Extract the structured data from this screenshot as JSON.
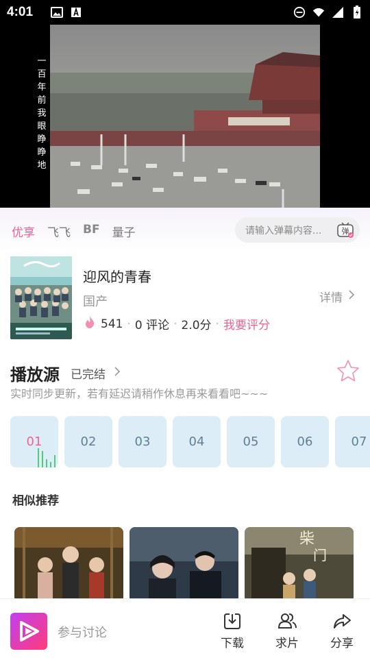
{
  "status_bar": {
    "time": "4:01",
    "icons": [
      "image-icon",
      "a-icon",
      "dnd-icon",
      "wifi-icon",
      "signal-icon",
      "battery-icon"
    ]
  },
  "video": {
    "vertical_caption": "一百年前我眼睁睁地"
  },
  "source_tabs": [
    {
      "label": "优享",
      "active": true
    },
    {
      "label": "飞飞",
      "active": false
    },
    {
      "label": "BF",
      "active": false
    },
    {
      "label": "量子",
      "active": false
    }
  ],
  "danmaku": {
    "placeholder": "请输入弹幕内容...",
    "icon_label": "弹"
  },
  "movie": {
    "title": "迎风的青春",
    "region": "国产",
    "details_label": "详情",
    "heat": "541",
    "comments": "0 评论",
    "score": "2.0分",
    "rate_label": "我要评分"
  },
  "play_source": {
    "title": "播放源",
    "status": "已完结",
    "note": "实时同步更新，若有延迟请稍作休息再来看看吧~~~",
    "episodes": [
      "01",
      "02",
      "03",
      "04",
      "05",
      "06",
      "07"
    ],
    "active_episode": "01"
  },
  "similar": {
    "title": "相似推荐"
  },
  "bottom_bar": {
    "discuss": "参与讨论",
    "download": "下载",
    "request": "求片",
    "share": "分享"
  },
  "colors": {
    "accent": "#f06292",
    "episode_bg": "#dcedf8",
    "logo_gradient_start": "#c040f0",
    "logo_gradient_end": "#ff3b7a"
  }
}
